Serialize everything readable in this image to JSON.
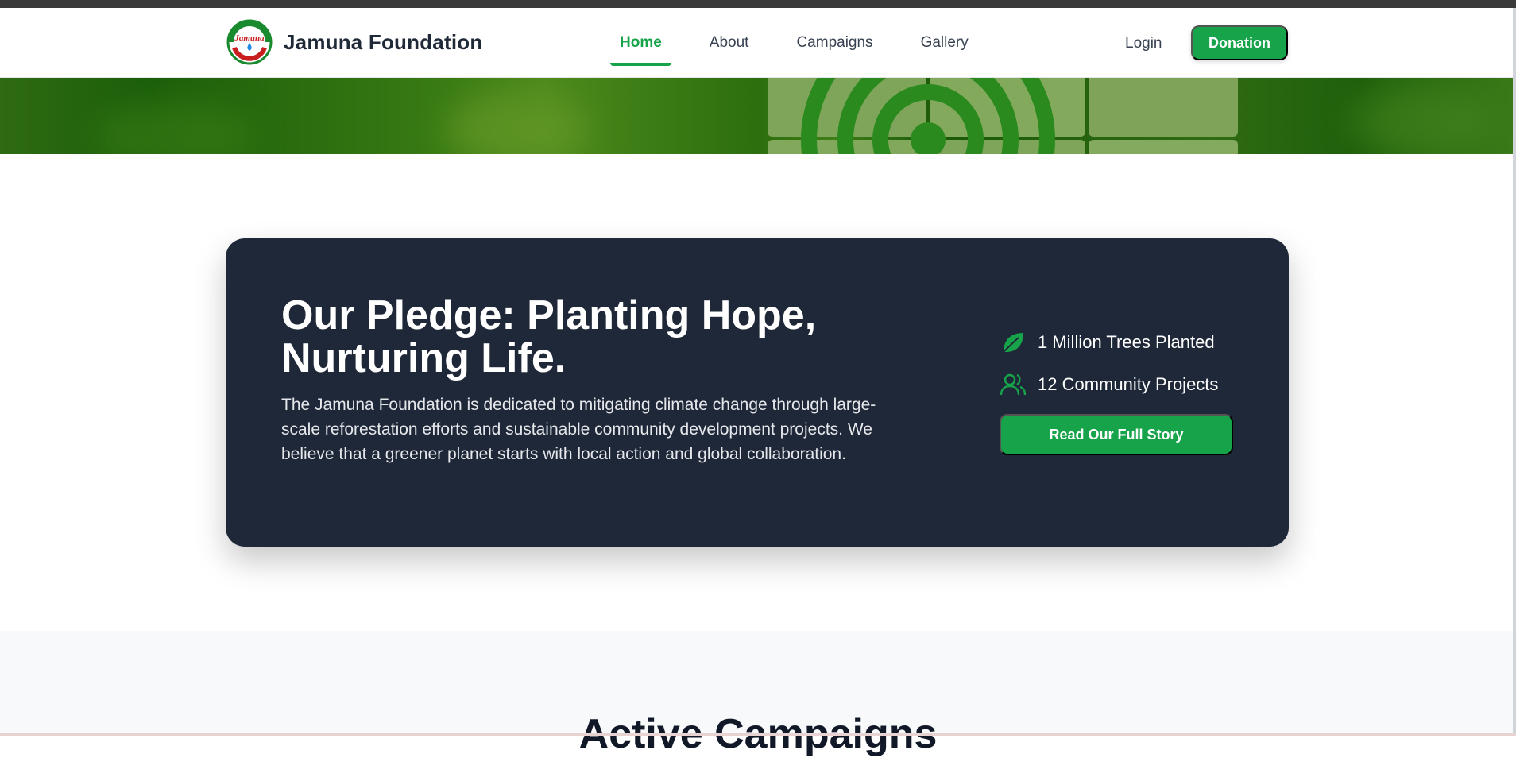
{
  "brand": {
    "name": "Jamuna Foundation",
    "logo_text": "Jamuna",
    "logo_icon": "jamuna-logo-icon"
  },
  "nav": {
    "items": [
      {
        "label": "Home",
        "active": true
      },
      {
        "label": "About",
        "active": false
      },
      {
        "label": "Campaigns",
        "active": false
      },
      {
        "label": "Gallery",
        "active": false
      }
    ],
    "login_label": "Login",
    "donation_label": "Donation"
  },
  "pledge": {
    "title": "Our Pledge: Planting Hope, Nurturing Life.",
    "body": "The Jamuna Foundation is dedicated to mitigating climate change through large-scale reforestation efforts and sustainable community development projects. We believe that a greener planet starts with local action and global collaboration.",
    "stats": [
      {
        "icon": "leaf-icon",
        "text": "1 Million Trees Planted"
      },
      {
        "icon": "users-icon",
        "text": "12 Community Projects"
      }
    ],
    "cta_label": "Read Our Full Story"
  },
  "campaigns": {
    "title": "Active Campaigns"
  },
  "colors": {
    "accent": "#16a34a",
    "card_bg": "#1f2838",
    "text_dark": "#1f2937"
  }
}
